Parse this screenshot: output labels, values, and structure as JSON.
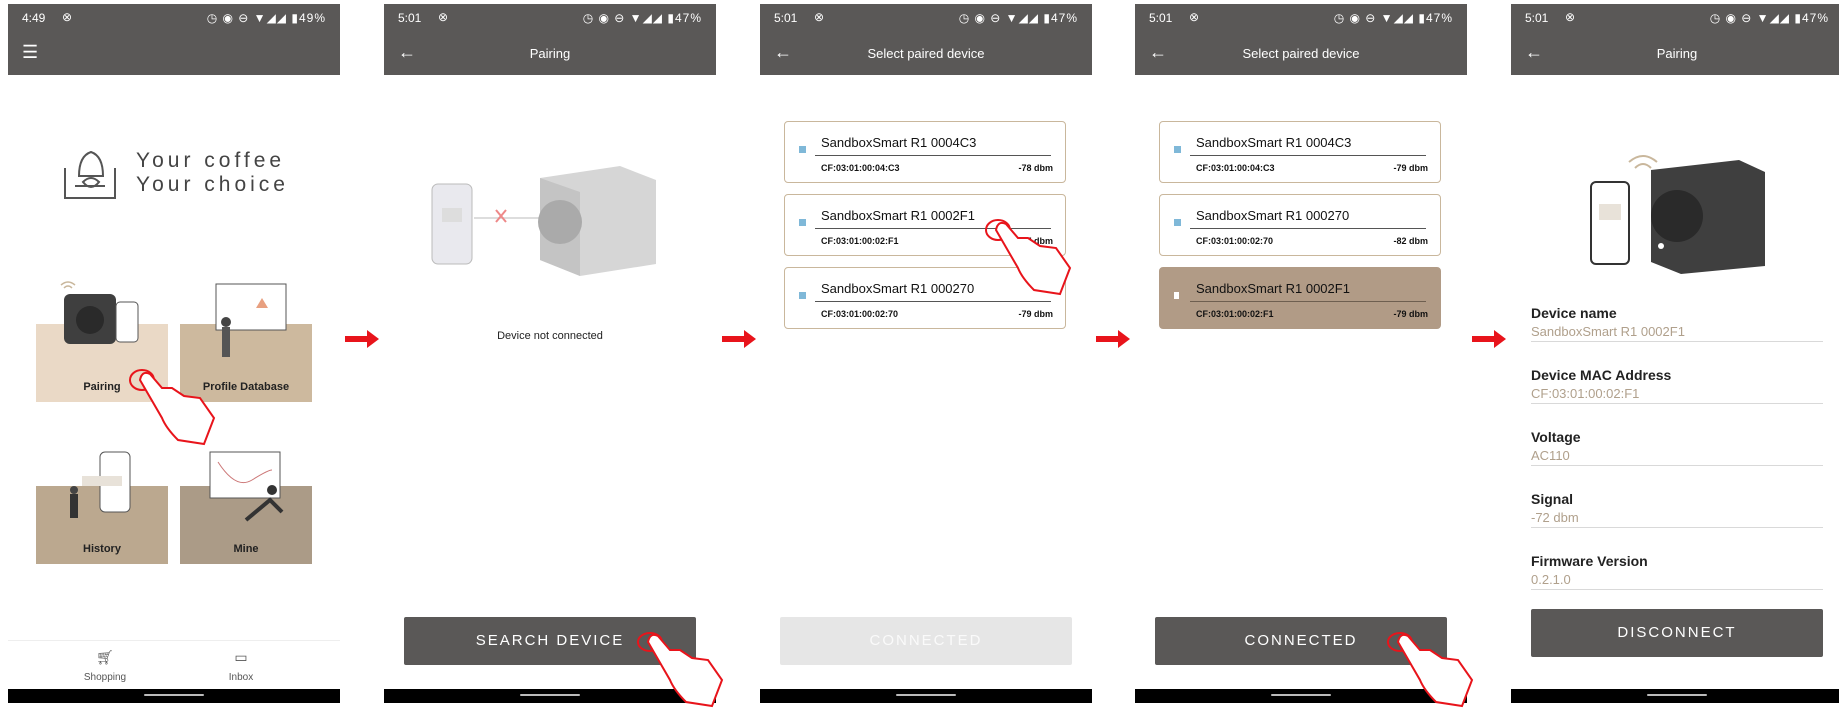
{
  "screens": [
    {
      "status": {
        "time": "4:49",
        "battery": "49%"
      },
      "appbar": {
        "title": ""
      },
      "tagline": {
        "line1": "Your coffee",
        "line2": "Your choice"
      },
      "tiles": [
        {
          "label": "Pairing"
        },
        {
          "label": "Profile Database"
        },
        {
          "label": "History"
        },
        {
          "label": "Mine"
        }
      ],
      "bottom_nav": [
        {
          "label": "Shopping",
          "icon": "cart-icon"
        },
        {
          "label": "Inbox",
          "icon": "inbox-icon"
        }
      ]
    },
    {
      "status": {
        "time": "5:01",
        "battery": "47%"
      },
      "appbar": {
        "title": "Pairing"
      },
      "status_text": "Device not connected",
      "button": "SEARCH DEVICE"
    },
    {
      "status": {
        "time": "5:01",
        "battery": "47%"
      },
      "appbar": {
        "title": "Select paired device"
      },
      "devices": [
        {
          "name": "SandboxSmart R1 0004C3",
          "mac": "CF:03:01:00:04:C3",
          "signal": "-78 dbm"
        },
        {
          "name": "SandboxSmart R1 0002F1",
          "mac": "CF:03:01:00:02:F1",
          "signal": "-77 dbm"
        },
        {
          "name": "SandboxSmart R1 000270",
          "mac": "CF:03:01:00:02:70",
          "signal": "-79 dbm"
        }
      ],
      "button": "CONNECTED"
    },
    {
      "status": {
        "time": "5:01",
        "battery": "47%"
      },
      "appbar": {
        "title": "Select paired device"
      },
      "devices": [
        {
          "name": "SandboxSmart R1 0004C3",
          "mac": "CF:03:01:00:04:C3",
          "signal": "-79 dbm"
        },
        {
          "name": "SandboxSmart R1 000270",
          "mac": "CF:03:01:00:02:70",
          "signal": "-82 dbm"
        },
        {
          "name": "SandboxSmart R1 0002F1",
          "mac": "CF:03:01:00:02:F1",
          "signal": "-79 dbm"
        }
      ],
      "button": "CONNECTED"
    },
    {
      "status": {
        "time": "5:01",
        "battery": "47%"
      },
      "appbar": {
        "title": "Pairing"
      },
      "fields": [
        {
          "label": "Device name",
          "value": "SandboxSmart R1 0002F1"
        },
        {
          "label": "Device MAC Address",
          "value": "CF:03:01:00:02:F1"
        },
        {
          "label": "Voltage",
          "value": "AC110"
        },
        {
          "label": "Signal",
          "value": "-72 dbm"
        },
        {
          "label": "Firmware Version",
          "value": "0.2.1.0"
        }
      ],
      "button": "DISCONNECT"
    }
  ],
  "colors": {
    "bar": "#5a5857",
    "accent_border": "#c9b79c",
    "selected_row": "#b19b86",
    "arrow": "#e8141b",
    "value_text": "#b0a08c"
  }
}
